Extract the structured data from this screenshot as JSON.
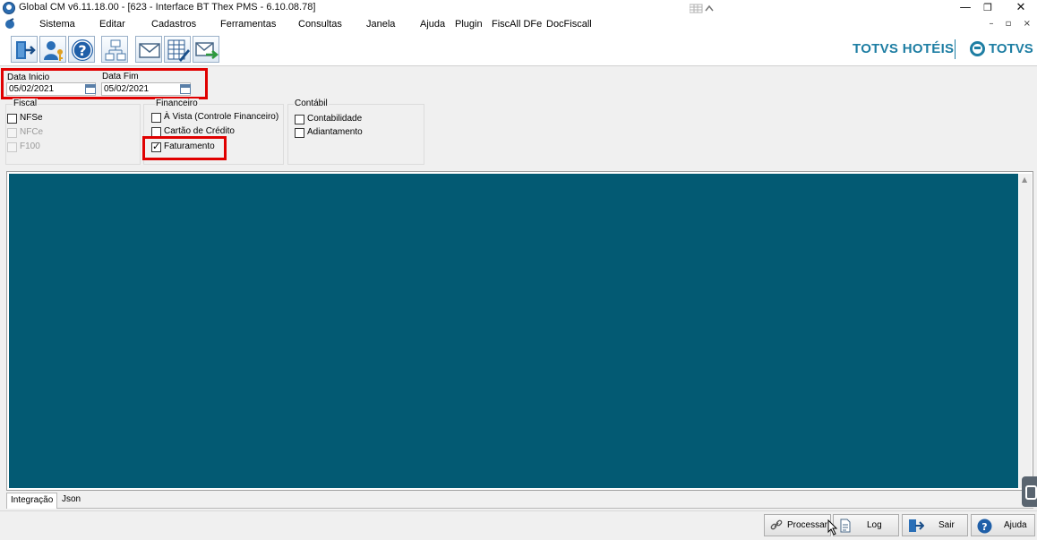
{
  "window": {
    "title": "Global CM v6.11.18.00 - [623 - Interface BT Thex PMS - 6.10.08.78]",
    "controls": {
      "minimize": "—",
      "restore": "❐",
      "close": "✕"
    }
  },
  "menu": {
    "items": [
      "Sistema",
      "Editar",
      "Cadastros",
      "Ferramentas",
      "Consultas",
      "Janela",
      "Ajuda",
      "Plugin",
      "FiscAll DFe",
      "DocFiscall"
    ],
    "mdi_controls": "– ▫ ×"
  },
  "toolbar": {
    "buttons": [
      {
        "icon": "exit-door-icon"
      },
      {
        "icon": "user-key-icon"
      },
      {
        "icon": "help-icon"
      },
      {
        "icon": "network-icon"
      },
      {
        "icon": "mail-icon"
      },
      {
        "icon": "spreadsheet-edit-icon"
      },
      {
        "icon": "mail-forward-icon"
      }
    ],
    "brand_hoteis": "TOTVS HOTÉIS",
    "brand_totvs": "TOTVS",
    "brand_color": "#1e7ea3"
  },
  "filters": {
    "data_inicio_label": "Data Inicio",
    "data_inicio_value": "05/02/2021",
    "data_fim_label": "Data Fim",
    "data_fim_value": "05/02/2021"
  },
  "groups": {
    "fiscal": {
      "title": "Fiscal",
      "options": [
        {
          "label": "NFSe",
          "checked": false,
          "enabled": true
        },
        {
          "label": "NFCe",
          "checked": false,
          "enabled": false
        },
        {
          "label": "F100",
          "checked": false,
          "enabled": false
        }
      ]
    },
    "financeiro": {
      "title": "Financeiro",
      "options": [
        {
          "label": "À Vista (Controle Financeiro)",
          "checked": false,
          "enabled": true
        },
        {
          "label": "Cartão de Crédito",
          "checked": false,
          "enabled": true
        },
        {
          "label": "Faturamento",
          "checked": true,
          "enabled": true
        }
      ]
    },
    "contabil": {
      "title": "Contábil",
      "options": [
        {
          "label": "Contabilidade",
          "checked": false,
          "enabled": true
        },
        {
          "label": "Adiantamento",
          "checked": false,
          "enabled": true
        }
      ]
    }
  },
  "main": {
    "background": "#035a73",
    "tabs": [
      "Integração",
      "Json"
    ],
    "active_tab": "Integração"
  },
  "bottom": {
    "processar_label": "Processar",
    "log_label": "Log",
    "sair_label": "Sair",
    "ajuda_label": "Ajuda"
  },
  "highlight_color": "#e00000"
}
